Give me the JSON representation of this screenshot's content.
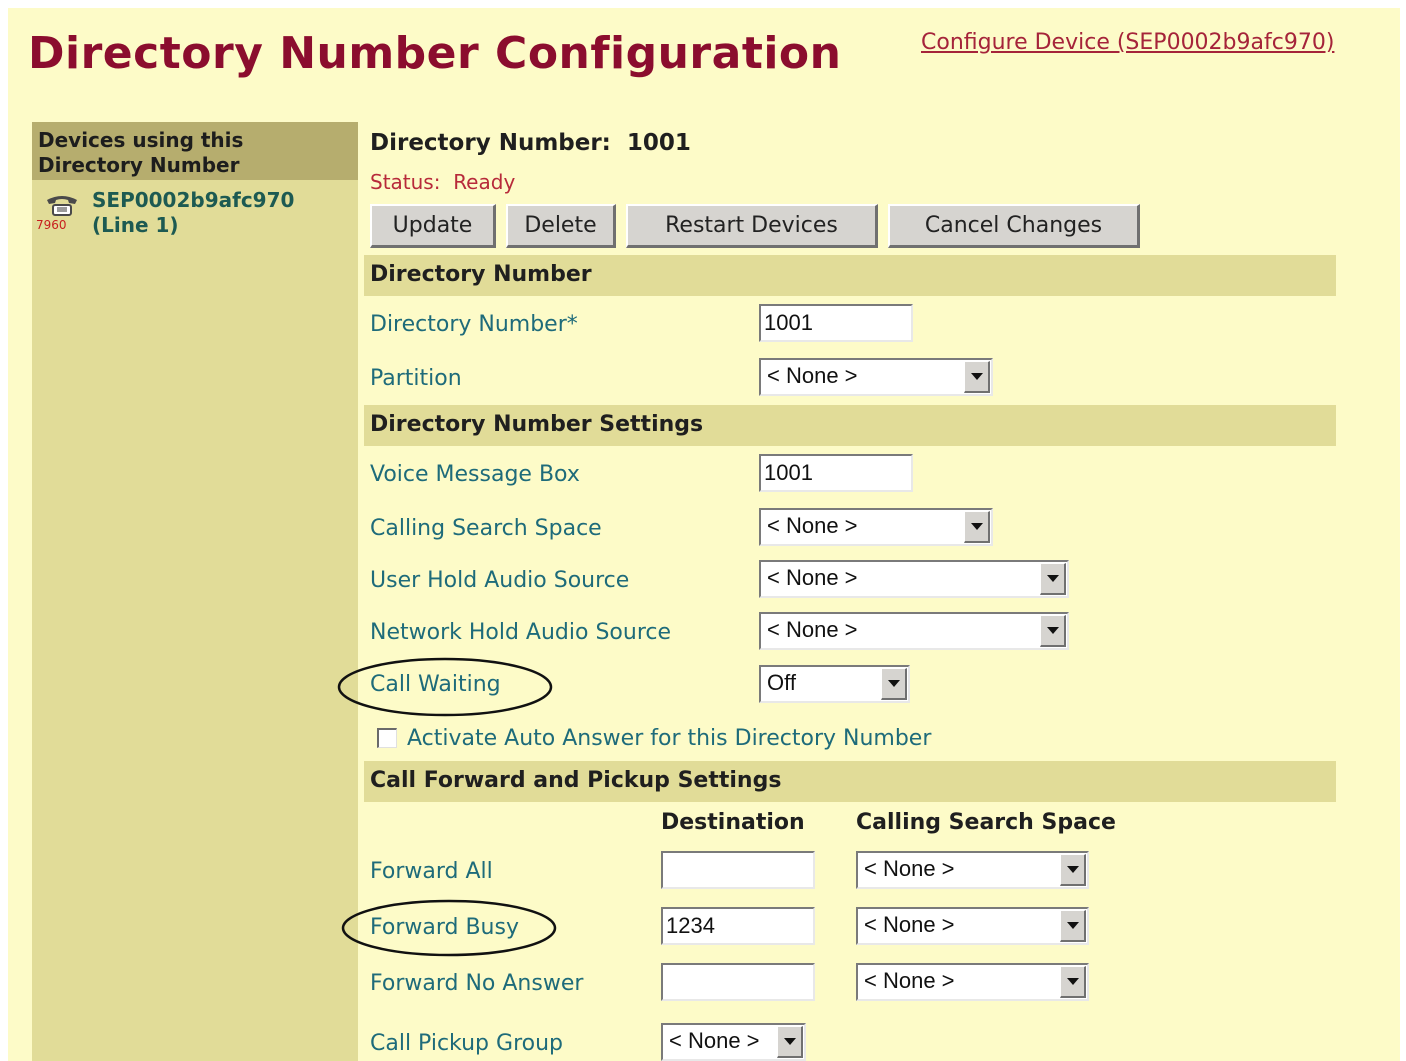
{
  "caption": "",
  "header": {
    "title": "Directory Number Configuration",
    "configure_link": "Configure Device (SEP0002b9afc970)"
  },
  "sidebar": {
    "header": "Devices using this Directory Number",
    "device": {
      "icon": "phone-icon",
      "model": "7960",
      "name": "SEP0002b9afc970",
      "line": "(Line 1)"
    }
  },
  "main": {
    "heading_label": "Directory Number:",
    "heading_value": "1001",
    "status_label": "Status:",
    "status_value": "Ready",
    "buttons": {
      "update": "Update",
      "delete": "Delete",
      "restart": "Restart Devices",
      "cancel": "Cancel Changes"
    }
  },
  "sections": {
    "directory_number": {
      "title": "Directory Number",
      "dn_label": "Directory Number*",
      "dn_value": "1001",
      "partition_label": "Partition",
      "partition_value": "< None >"
    },
    "settings": {
      "title": "Directory Number Settings",
      "voicemail_label": "Voice Message Box",
      "voicemail_value": "1001",
      "css_label": "Calling Search Space",
      "css_value": "< None >",
      "user_hold_label": "User Hold Audio Source",
      "user_hold_value": "< None >",
      "network_hold_label": "Network Hold Audio Source",
      "network_hold_value": "< None >",
      "call_waiting_label": "Call Waiting",
      "call_waiting_value": "Off",
      "auto_answer_label": "Activate Auto Answer for this Directory Number",
      "auto_answer_checked": false
    },
    "forward": {
      "title": "Call Forward and Pickup Settings",
      "col_destination": "Destination",
      "col_css": "Calling Search Space",
      "rows": [
        {
          "label": "Forward All",
          "destination": "",
          "css": "< None >"
        },
        {
          "label": "Forward Busy",
          "destination": "1234",
          "css": "< None >"
        },
        {
          "label": "Forward No Answer",
          "destination": "",
          "css": "< None >"
        }
      ],
      "pickup_label": "Call Pickup Group",
      "pickup_value": "< None >"
    }
  },
  "colors": {
    "title": "#8b0d2e",
    "page_background": "#fdfbc8",
    "sidebar": "#e1dc98",
    "field_label": "#1e6b7a",
    "status": "#b72a3a"
  }
}
